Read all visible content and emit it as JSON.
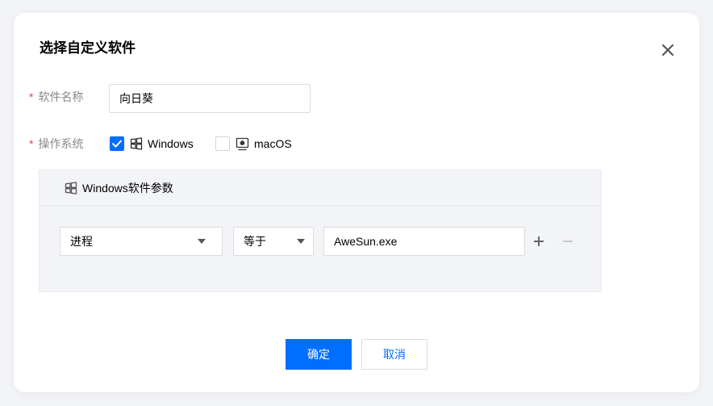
{
  "dialog": {
    "title": "选择自定义软件",
    "confirm_label": "确定",
    "cancel_label": "取消"
  },
  "form": {
    "name": {
      "required_mark": "*",
      "label": "软件名称",
      "value": "向日葵"
    },
    "os": {
      "required_mark": "*",
      "label": "操作系统",
      "options": [
        {
          "label": "Windows",
          "checked": true,
          "icon": "windows-icon"
        },
        {
          "label": "macOS",
          "checked": false,
          "icon": "mac-icon"
        }
      ]
    }
  },
  "panel": {
    "header": "Windows软件参数",
    "rule": {
      "field": "进程",
      "operator": "等于",
      "value": "AweSun.exe"
    }
  },
  "colors": {
    "primary": "#006eff",
    "required": "#e54545",
    "panel_bg": "#f3f4f7"
  }
}
